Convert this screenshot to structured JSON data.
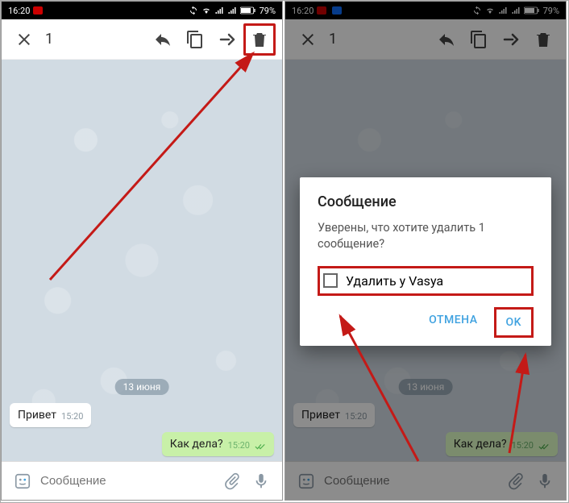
{
  "statusbar": {
    "time": "16:20",
    "battery": "79%"
  },
  "toolbar": {
    "selected_count": "1"
  },
  "chat": {
    "date_label": "13 июня",
    "msg_in_text": "Привет",
    "msg_in_time": "15:20",
    "msg_out_text": "Как дела?",
    "msg_out_time": "15:20"
  },
  "input": {
    "placeholder": "Сообщение"
  },
  "dialog": {
    "title": "Сообщение",
    "message": "Уверены, что хотите удалить 1 сообщение?",
    "checkbox_label": "Удалить у Vasya",
    "cancel": "ОТМЕНА",
    "ok": "OK"
  },
  "annotation": {
    "highlight_color": "#c41a17",
    "arrows": [
      "delete-button",
      "checkbox",
      "ok-button"
    ]
  }
}
